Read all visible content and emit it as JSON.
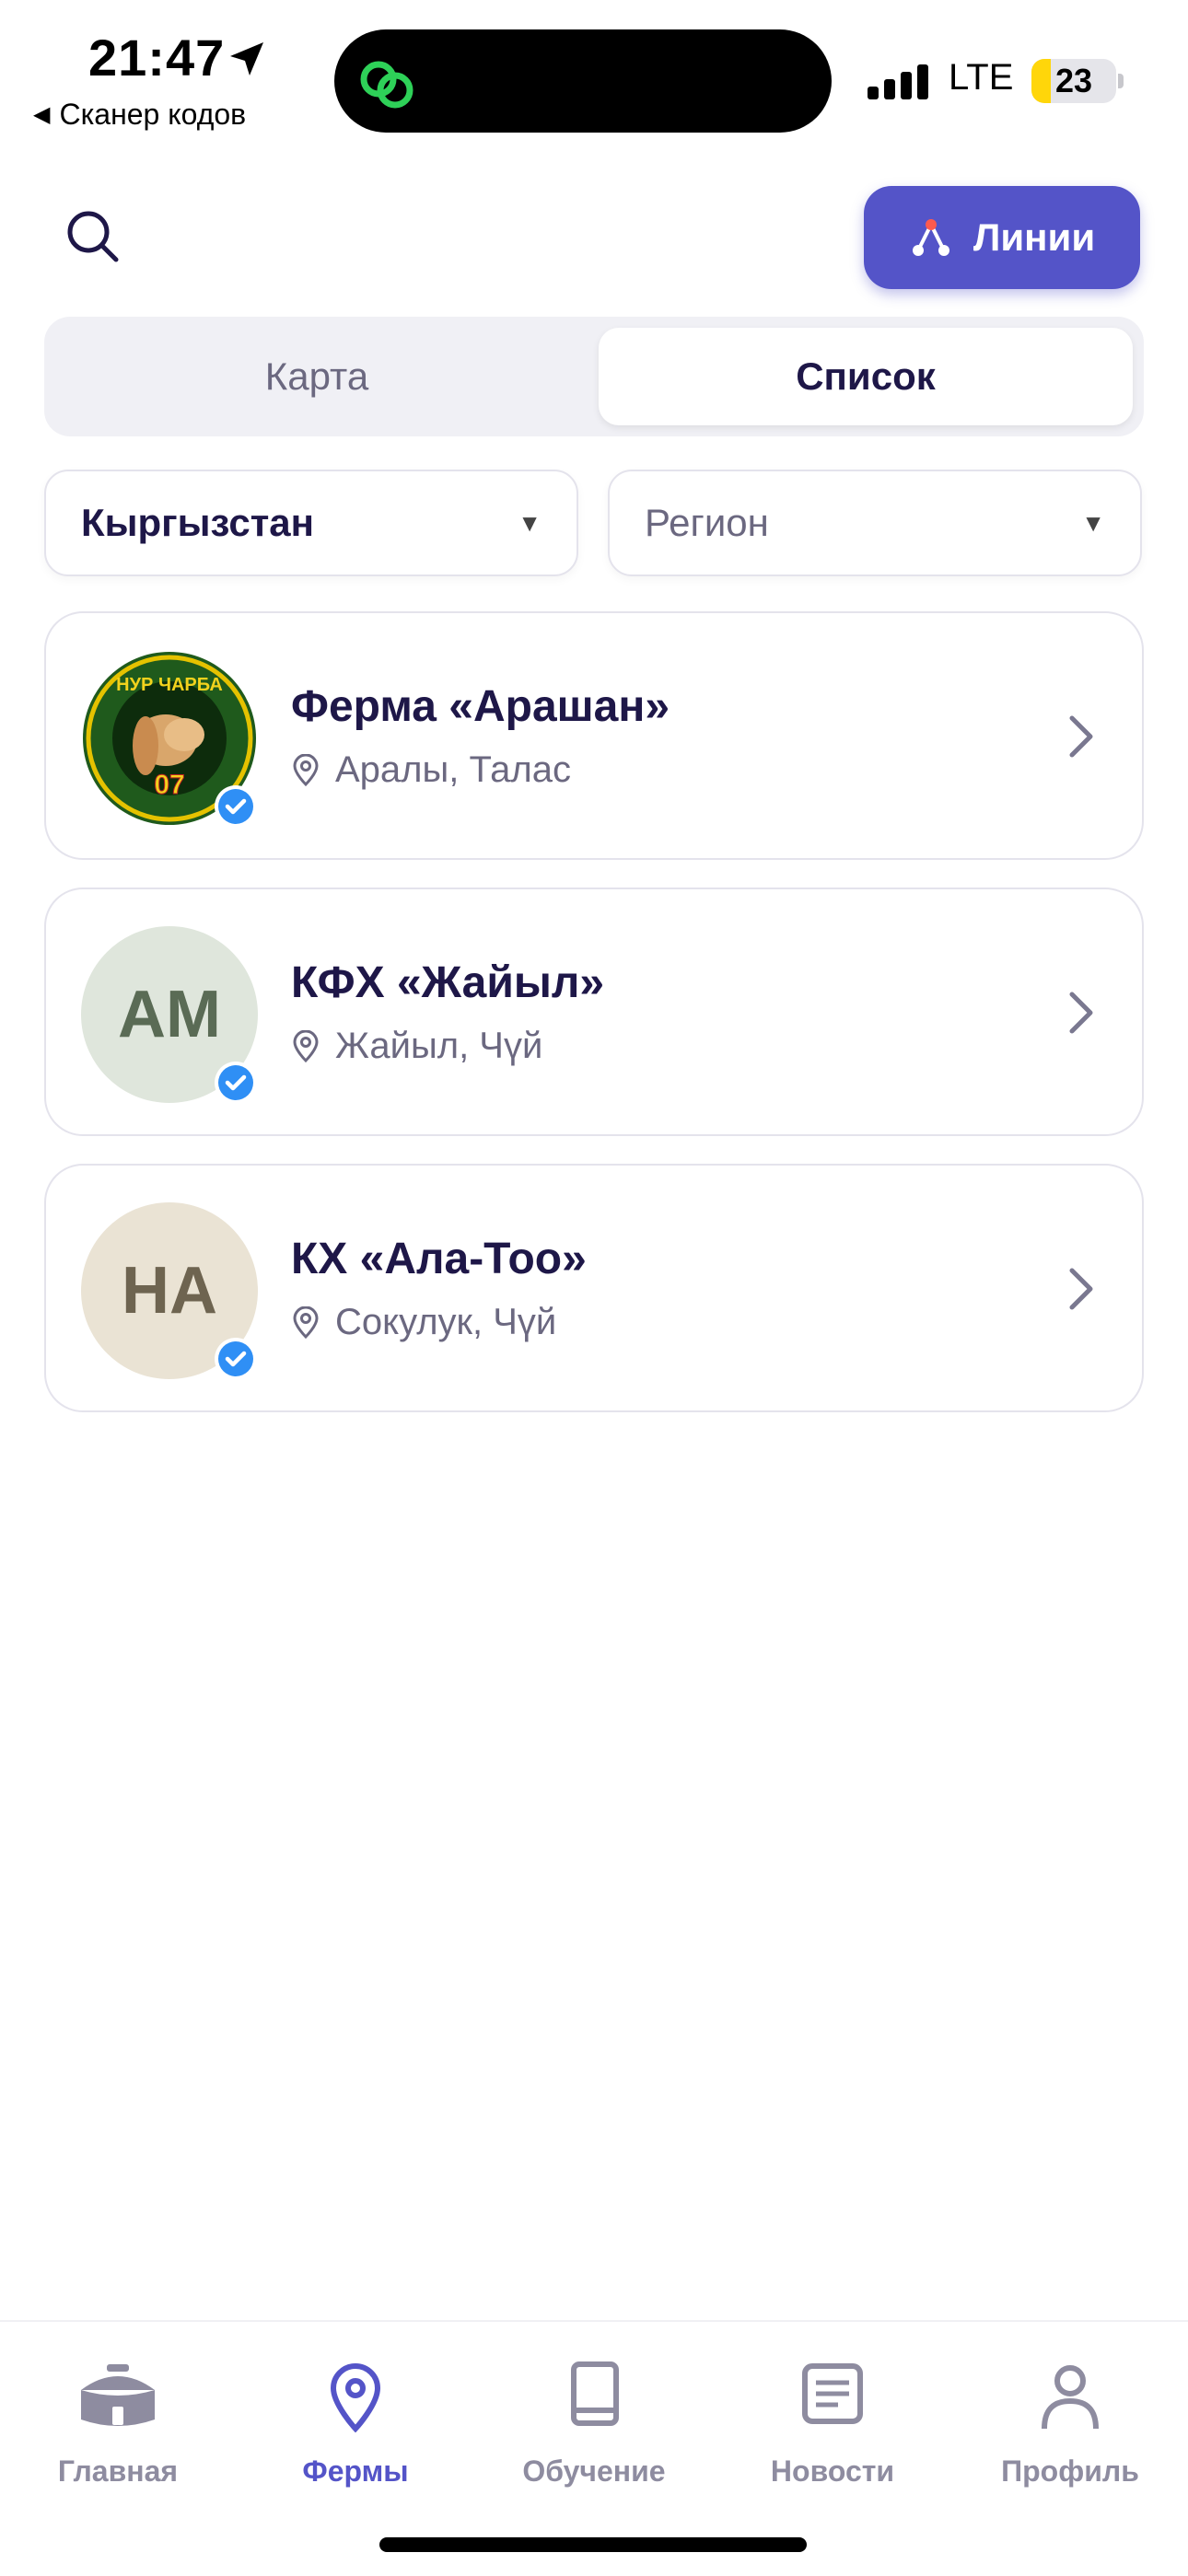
{
  "status_bar": {
    "time": "21:47",
    "back_label": "Сканер кодов",
    "network": "LTE",
    "battery_level": "23",
    "battery_fraction": 0.23,
    "icons": [
      "location-arrow-icon",
      "app-link-icon",
      "signal-icon",
      "battery-icon"
    ]
  },
  "header": {
    "search_icon": "search-icon",
    "lines_button_label": "Линии",
    "lines_icon": "tree-icon",
    "accent_color": "#5454c8"
  },
  "segmented": {
    "map_label": "Карта",
    "list_label": "Список",
    "selected": "list"
  },
  "filters": {
    "country": "Кыргызстан",
    "region_placeholder": "Регион"
  },
  "farms": [
    {
      "name": "Ферма «Арашан»",
      "location": "Аралы, Талас",
      "avatar_type": "logo",
      "logo_text": "НУР ЧАРБА",
      "logo_number": "07",
      "verified": true
    },
    {
      "name": "КФХ «Жайыл»",
      "location": "Жайыл, Чүй",
      "avatar_initials": "АМ",
      "avatar_bg": "#dfe6dc",
      "avatar_color": "#5a6b55",
      "verified": true
    },
    {
      "name": "КХ «Ала-Тоо»",
      "location": "Сокулук, Чүй",
      "avatar_initials": "НА",
      "avatar_bg": "#eae3d4",
      "avatar_color": "#6e6450",
      "verified": true
    }
  ],
  "tabbar": {
    "tabs": [
      {
        "label": "Главная",
        "icon": "yurt-icon"
      },
      {
        "label": "Фермы",
        "icon": "map-pin-icon"
      },
      {
        "label": "Обучение",
        "icon": "book-icon"
      },
      {
        "label": "Новости",
        "icon": "news-icon"
      },
      {
        "label": "Профиль",
        "icon": "person-icon"
      }
    ],
    "active": "Фермы"
  }
}
